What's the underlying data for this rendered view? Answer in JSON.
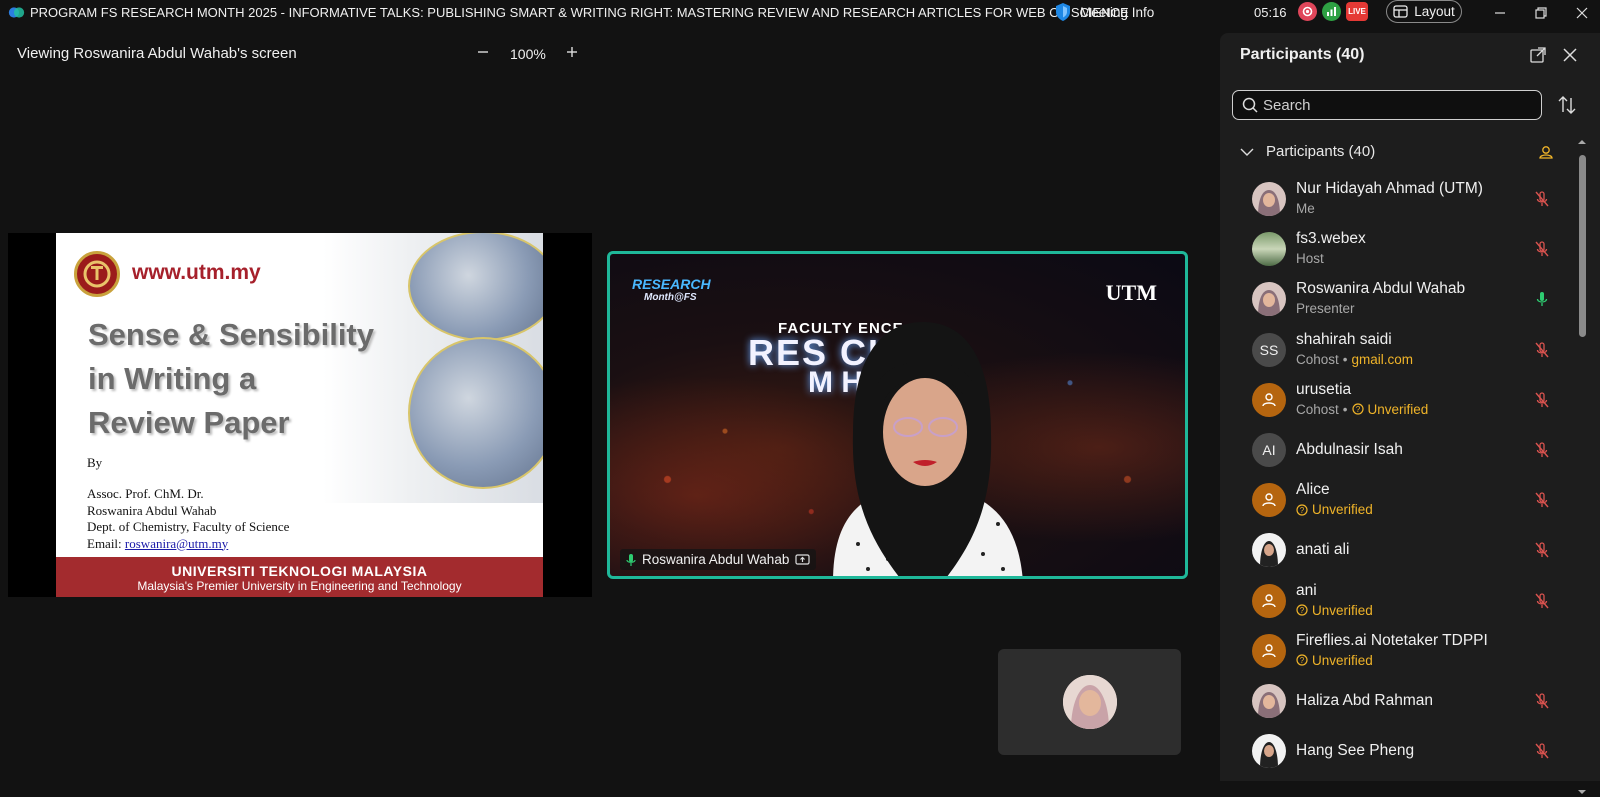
{
  "titlebar": {
    "meeting_title": "PROGRAM FS RESEARCH MONTH 2025 - INFORMATIVE TALKS: PUBLISHING SMART & WRITING RIGHT: MASTERING REVIEW AND RESEARCH ARTICLES FOR WEB OF SCIENCE",
    "meeting_info_label": "Meeting Info",
    "clock": "05:16",
    "live_badge": "LIVE",
    "layout_label": "Layout"
  },
  "stage": {
    "viewing_label": "Viewing Roswanira Abdul Wahab's screen",
    "zoom_level": "100%"
  },
  "slide": {
    "url": "www.utm.my",
    "title_lines": [
      "Sense & Sensibility",
      "in Writing a",
      "Review Paper"
    ],
    "by": "By",
    "author_lines": [
      "Assoc. Prof. ChM. Dr.",
      "Roswanira Abdul Wahab",
      "Dept. of Chemistry, Faculty of Science"
    ],
    "email_prefix": "Email: ",
    "email": "roswanira@utm.my",
    "footer_line1": "UNIVERSITI TEKNOLOGI MALAYSIA",
    "footer_line2": "Malaysia's Premier University in Engineering and Technology"
  },
  "video": {
    "bg_logo_line1": "RESEARCH",
    "bg_logo_line2": "Month@FS",
    "bg_utm": "UTM",
    "bg_faculty": "FACULTY    ENCE",
    "bg_research": "RES     CH",
    "bg_month": "M     H",
    "speaker_name": "Roswanira Abdul Wahab"
  },
  "panel": {
    "title": "Participants (40)",
    "search_placeholder": "Search",
    "group_label": "Participants (40)",
    "participants": [
      {
        "name": "Nur Hidayah Ahmad (UTM)",
        "role": "Me",
        "extra": "",
        "initials": "",
        "avatar": "photo",
        "mic": "muted"
      },
      {
        "name": "fs3.webex",
        "role": "Host",
        "extra": "",
        "initials": "",
        "avatar": "photo-green",
        "mic": "muted"
      },
      {
        "name": "Roswanira Abdul Wahab",
        "role": "Presenter",
        "extra": "",
        "initials": "",
        "avatar": "photo",
        "mic": "active"
      },
      {
        "name": "shahirah saidi",
        "role": "Cohost",
        "extra": "gmail.com",
        "initials": "SS",
        "avatar": "initials",
        "mic": "muted"
      },
      {
        "name": "urusetia",
        "role": "Cohost",
        "extra": "Unverified",
        "initials": "",
        "avatar": "guest",
        "mic": "muted"
      },
      {
        "name": "Abdulnasir Isah",
        "role": "",
        "extra": "",
        "initials": "AI",
        "avatar": "initials",
        "mic": "muted"
      },
      {
        "name": "Alice",
        "role": "",
        "extra": "Unverified",
        "initials": "",
        "avatar": "guest",
        "mic": "muted"
      },
      {
        "name": "anati ali",
        "role": "",
        "extra": "",
        "initials": "",
        "avatar": "photo-white",
        "mic": "muted"
      },
      {
        "name": "ani",
        "role": "",
        "extra": "Unverified",
        "initials": "",
        "avatar": "guest",
        "mic": "muted"
      },
      {
        "name": "Fireflies.ai Notetaker TDPPI",
        "role": "",
        "extra": "Unverified",
        "initials": "",
        "avatar": "guest",
        "mic": "none"
      },
      {
        "name": "Haliza Abd Rahman",
        "role": "",
        "extra": "",
        "initials": "",
        "avatar": "photo",
        "mic": "muted"
      },
      {
        "name": "Hang See Pheng",
        "role": "",
        "extra": "",
        "initials": "",
        "avatar": "photo-white",
        "mic": "muted"
      }
    ]
  },
  "colors": {
    "accent_teal": "#1fb89a",
    "unverified_gold": "#f0b429",
    "muted_red": "#d9534f",
    "active_green": "#2ecc71",
    "utm_red": "#a32b2e"
  }
}
